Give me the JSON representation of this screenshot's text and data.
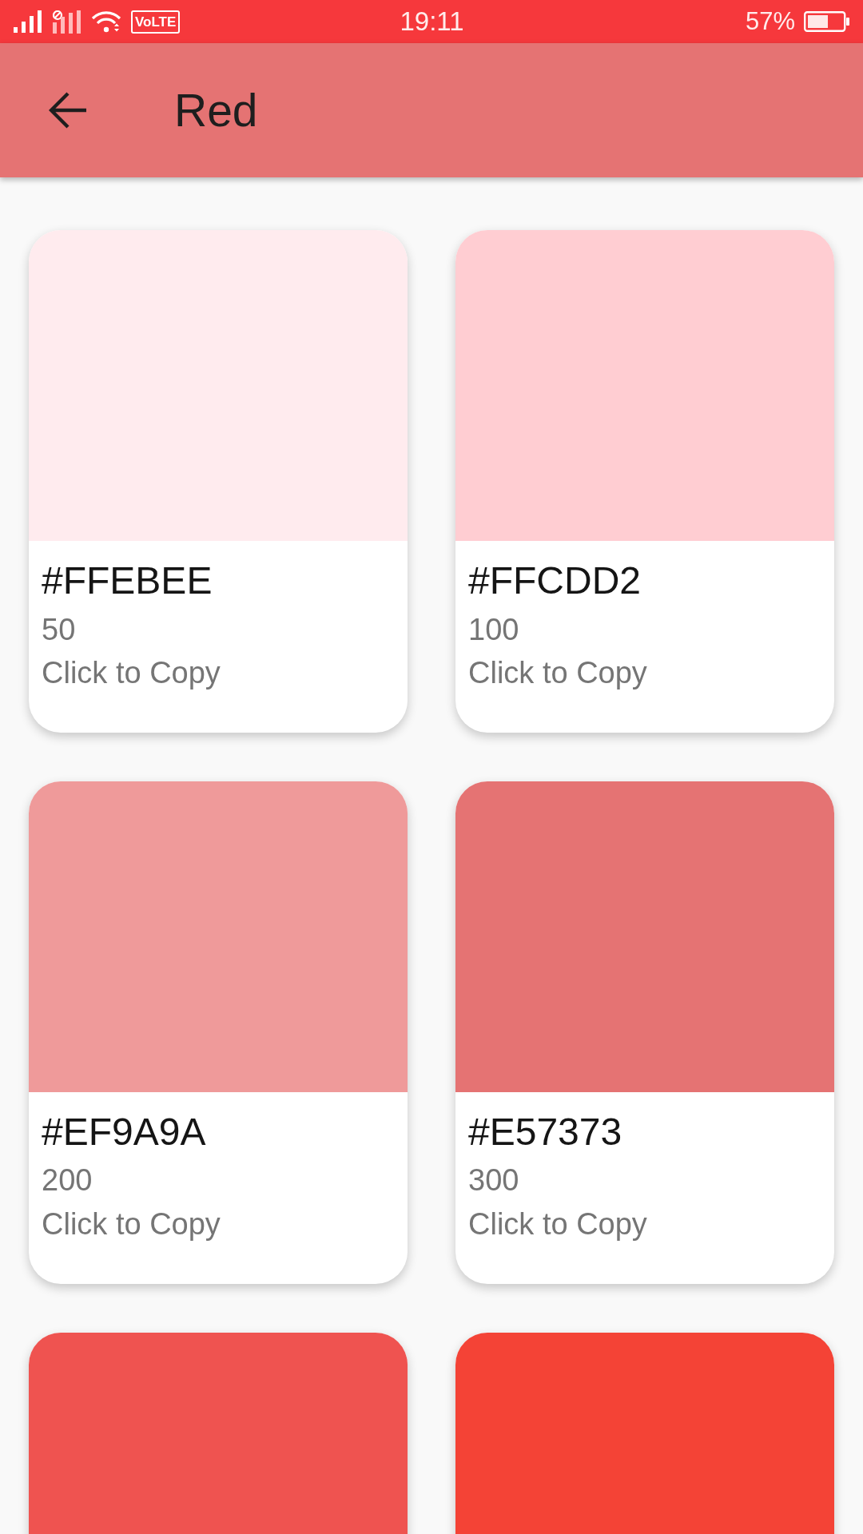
{
  "status_bar": {
    "network_label": "VoLTE",
    "time": "19:11",
    "battery": "57%"
  },
  "app_bar": {
    "title": "Red"
  },
  "swatches": [
    {
      "hex": "#FFEBEE",
      "shade": "50",
      "hint": "Click to Copy",
      "color": "#ffebee"
    },
    {
      "hex": "#FFCDD2",
      "shade": "100",
      "hint": "Click to Copy",
      "color": "#ffcdd2"
    },
    {
      "hex": "#EF9A9A",
      "shade": "200",
      "hint": "Click to Copy",
      "color": "#ef9a9a"
    },
    {
      "hex": "#E57373",
      "shade": "300",
      "hint": "Click to Copy",
      "color": "#e57373"
    },
    {
      "color": "#ef5350"
    },
    {
      "color": "#f44336"
    }
  ]
}
